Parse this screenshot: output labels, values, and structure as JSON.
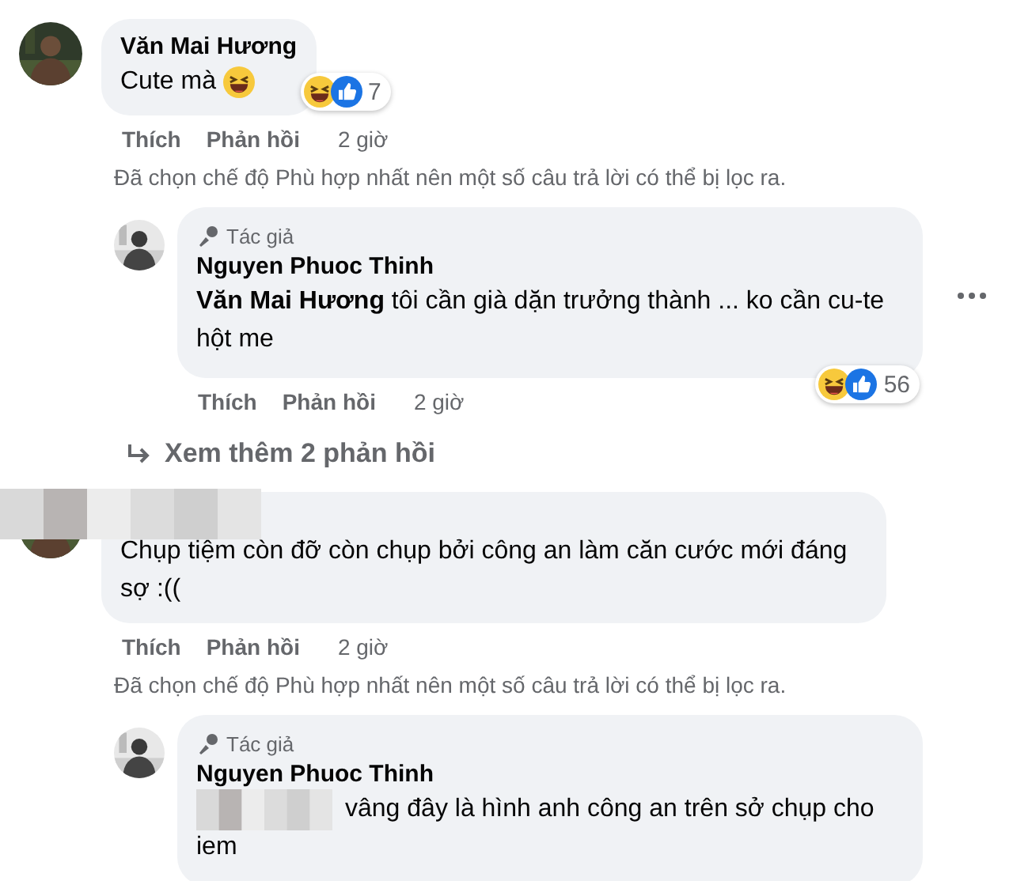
{
  "threads": [
    {
      "comment": {
        "kind": "comment",
        "author": "Văn Mai Hương",
        "text": "Cute mà",
        "emoji": true,
        "reactions": {
          "count": "7"
        },
        "actions": [
          {
            "label": "Thích"
          },
          {
            "label": "Phản hồi"
          }
        ],
        "time": "2 giờ"
      },
      "note": "Đã chọn chế độ Phù hợp nhất nên một số câu trả lời có thể bị lọc ra.",
      "replies": [
        {
          "kind": "reply",
          "badge": "Tác giả",
          "author": "Nguyen Phuoc Thinh",
          "text": "**Văn Mai Hương** tôi cần già dặn trưởng thành ... ko cần cu-te hột me",
          "more_button": true,
          "reactions": {
            "count": "56"
          },
          "actions": [
            {
              "label": "Thích"
            },
            {
              "label": "Phản hồi"
            }
          ],
          "time": "2 giờ"
        }
      ],
      "more_replies": "Xem thêm 2 phản hồi"
    },
    {
      "comment": {
        "kind": "comment",
        "author_hidden": true,
        "text": "Chụp tiệm còn đỡ còn chụp bởi công an làm căn cước mới đáng sợ :((",
        "actions": [
          {
            "label": "Thích"
          },
          {
            "label": "Phản hồi"
          }
        ],
        "time": "2 giờ"
      },
      "note": "Đã chọn chế độ Phù hợp nhất nên một số câu trả lời có thể bị lọc ra.",
      "replies": [
        {
          "kind": "reply",
          "badge": "Tác giả",
          "author": "Nguyen Phuoc Thinh",
          "mention_hidden": true,
          "text": "vâng đây là hình anh công an trên sở chụp cho iem"
        }
      ]
    }
  ]
}
